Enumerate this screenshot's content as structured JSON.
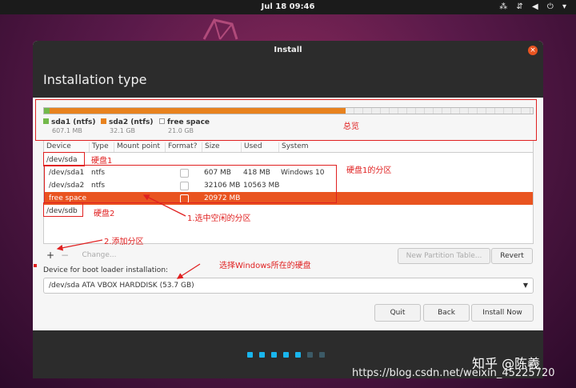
{
  "topbar": {
    "clock": "Jul 18  09:46",
    "tray": "⁂ ⇵ ◀ ⏻ ▾"
  },
  "dialog": {
    "title": "Install",
    "close_glyph": "×",
    "heading": "Installation type"
  },
  "partition_bar": {
    "segments": [
      {
        "name": "sda1 (ntfs)",
        "size": "607.1 MB",
        "color": "#73b94b"
      },
      {
        "name": "sda2 (ntfs)",
        "size": "32.1 GB",
        "color": "#e8821e"
      },
      {
        "name": "free space",
        "size": "21.0 GB",
        "color": "#ffffff"
      }
    ]
  },
  "table": {
    "columns": [
      "Device",
      "Type",
      "Mount point",
      "Format?",
      "Size",
      "Used",
      "System"
    ],
    "rows": [
      {
        "device": "/dev/sda"
      },
      {
        "device": "/dev/sda1",
        "type": "ntfs",
        "size": "607 MB",
        "used": "418 MB",
        "system": "Windows 10"
      },
      {
        "device": "/dev/sda2",
        "type": "ntfs",
        "size": "32106 MB",
        "used": "10563 MB",
        "system": ""
      },
      {
        "device": "free space",
        "size": "20972 MB",
        "selected": true
      },
      {
        "device": "/dev/sdb"
      }
    ]
  },
  "toolbar": {
    "add": "+",
    "remove": "−",
    "change": "Change...",
    "new_table": "New Partition Table...",
    "revert": "Revert"
  },
  "bootloader": {
    "label": "Device for boot loader installation:",
    "value": "/dev/sda    ATA VBOX HARDDISK (53.7 GB)",
    "arrow": "▼"
  },
  "buttons": {
    "quit": "Quit",
    "back": "Back",
    "install": "Install Now"
  },
  "progress": {
    "steps_total": 7,
    "steps_done": 5,
    "active_color": "#19b6ee",
    "inactive_color": "#3c5a66"
  },
  "annotations": {
    "overview": "总览",
    "disk1": "硬盘1",
    "disk1_partitions": "硬盘1的分区",
    "select_free": "1.选中空闲的分区",
    "disk2": "硬盘2",
    "add_partition": "2.添加分区",
    "choose_disk": "选择Windows所在的硬盘"
  },
  "watermark": {
    "zhihu": "知乎 @陈羲",
    "url": "https://blog.csdn.net/weixin_45225720"
  },
  "colors": {
    "accent": "#e95420",
    "annotation": "#e02020"
  }
}
